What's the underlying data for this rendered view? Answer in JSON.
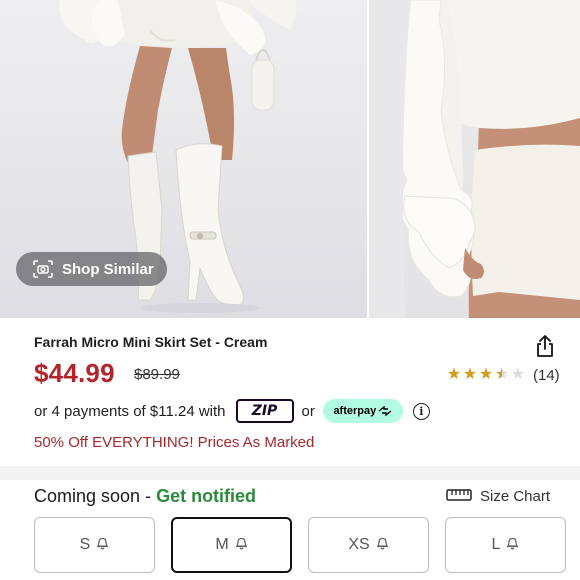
{
  "gallery": {
    "images": [
      {
        "alt": "model-full-body"
      },
      {
        "alt": "model-closeup"
      }
    ],
    "shop_similar": {
      "label": "Shop Similar",
      "icon": "camera-scan-icon"
    }
  },
  "product": {
    "title": "Farrah Micro Mini Skirt Set - Cream",
    "price": "$44.99",
    "original_price": "$89.99",
    "price_color": "#b5232b",
    "rating": {
      "stars": 3.5,
      "max": 5,
      "count_label": "(14)",
      "star_color": "#d29a1c"
    },
    "share_icon": "share-icon"
  },
  "payments": {
    "text": "or 4 payments of $11.24 with",
    "zip_label": "ZIP",
    "or_label": "or",
    "afterpay_label": "afterpay",
    "afterpay_color": "#b2fce4",
    "info_icon": "info-icon"
  },
  "promo": {
    "text": "50% Off EVERYTHING! Prices As Marked",
    "color": "#a6282e"
  },
  "sizing": {
    "status_text": "Coming soon",
    "separator": " - ",
    "notify_label": "Get notified",
    "notify_color": "#2c8a3f",
    "size_chart_label": "Size Chart",
    "size_chart_icon": "ruler-icon",
    "options": [
      {
        "label": "S",
        "selected": false
      },
      {
        "label": "M",
        "selected": true
      },
      {
        "label": "XS",
        "selected": false
      },
      {
        "label": "L",
        "selected": false
      }
    ],
    "notify_icon": "bell-icon"
  }
}
